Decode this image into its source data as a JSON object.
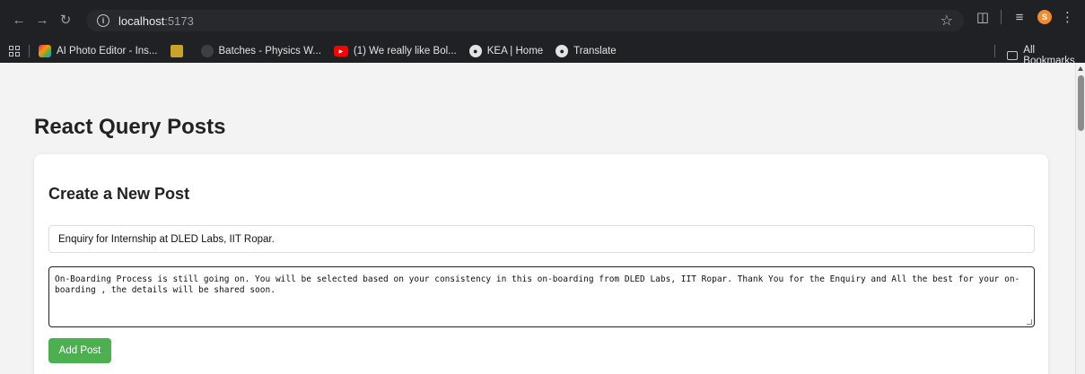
{
  "browser": {
    "url_host": "localhost",
    "url_port": ":5173",
    "bookmarks": [
      {
        "label": "AI Photo Editor - Ins...",
        "icon": "photo-editor-icon"
      },
      {
        "label": "",
        "icon": "square-logo-icon"
      },
      {
        "label": "Batches - Physics W...",
        "icon": "physics-wallah-icon"
      },
      {
        "label": "(1) We really like Bol...",
        "icon": "youtube-icon"
      },
      {
        "label": "KEA | Home",
        "icon": "globe-icon"
      },
      {
        "label": "Translate",
        "icon": "globe-icon"
      }
    ],
    "all_bookmarks_label": "All Bookmarks",
    "avatar_letter": "S"
  },
  "page": {
    "title": "React Query Posts",
    "form": {
      "heading": "Create a New Post",
      "title_value": "Enquiry for Internship at DLED Labs, IIT Ropar.",
      "body_value": "On-Boarding Process is still going on. You will be selected based on your consistency in this on-boarding from DLED Labs, IIT Ropar. Thank You for the Enquiry and All the best for your on-boarding , the details will be shared soon.",
      "submit_label": "Add Post"
    }
  },
  "colors": {
    "chrome_bg": "#202124",
    "accent_green": "#4caf50",
    "page_bg": "#f3f3f3"
  }
}
